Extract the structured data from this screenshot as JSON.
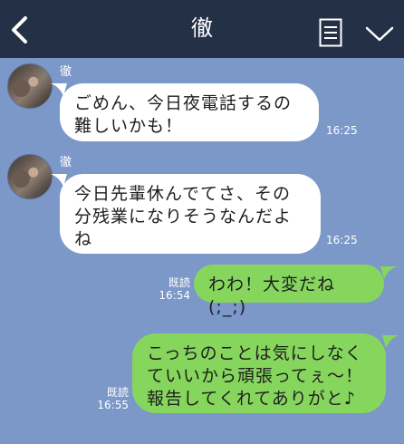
{
  "header": {
    "title": "徹"
  },
  "messages": [
    {
      "sender": "徹",
      "lines": [
        "ごめん、今日夜電話するの",
        "難しいかも！"
      ],
      "time": "16:25"
    },
    {
      "sender": "徹",
      "lines": [
        "今日先輩休んでてさ、その",
        "分残業になりそうなんだよ",
        "ね"
      ],
      "time": "16:25"
    },
    {
      "read": "既読",
      "time": "16:54",
      "lines": [
        "わわ！大変だね(;_;)"
      ]
    },
    {
      "read": "既読",
      "time": "16:55",
      "lines": [
        "こっちのことは気にしなく",
        "ていいから頑張ってぇ〜！",
        "報告してくれてありがと♪"
      ]
    }
  ],
  "colors": {
    "background": "#7b98c8",
    "header": "#243046",
    "incoming_bubble": "#ffffff",
    "outgoing_bubble": "#86d65e"
  },
  "icons": [
    "back-arrow-icon",
    "menu-list-icon",
    "chevron-down-icon"
  ]
}
